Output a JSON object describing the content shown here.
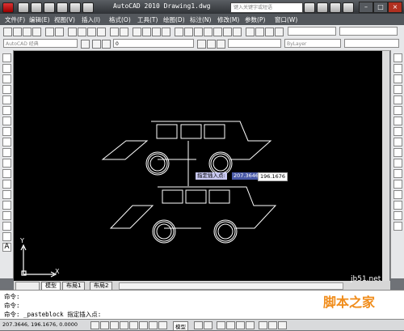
{
  "window": {
    "title": "AutoCAD 2010  Drawing1.dwg",
    "search_placeholder": "键入关键字或短语"
  },
  "menu": [
    "文件(F)",
    "编辑(E)",
    "视图(V)",
    "插入(I)",
    "格式(O)",
    "工具(T)",
    "绘图(D)",
    "标注(N)",
    "修改(M)",
    "参数(P)",
    "窗口(W)"
  ],
  "toolbar": {
    "workspace": "AutoCAD 经典",
    "layer": "0",
    "linetype": "ByLayer"
  },
  "tooltip": {
    "prompt": "指定插入点:",
    "x_value": "207.3646",
    "y_value": "196.1676"
  },
  "ucs": {
    "y_label": "Y",
    "x_label": "X"
  },
  "tabs": [
    "模型",
    "布局1",
    "布局2"
  ],
  "command": {
    "line1": "命令:",
    "line2": "命令:",
    "line3": "命令: _pasteblock 指定插入点:"
  },
  "status": {
    "coords": "207.3646, 196.1676, 0.0000",
    "model": "模型"
  },
  "watermark": {
    "site": "jb51.net",
    "text": "脚本之家"
  },
  "colors": {
    "canvas": "#000000",
    "menubar": "#53575c",
    "tooltip_bg": "#c9c9f2",
    "watermark": "#f08c1a"
  }
}
